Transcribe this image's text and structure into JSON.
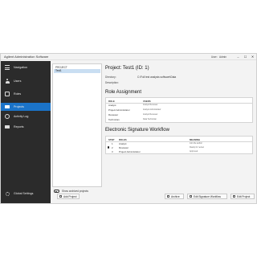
{
  "window": {
    "title": "Agilent Administration Software",
    "user_label": "User:",
    "user_value": "Admin",
    "minimize": "–",
    "maximize": "☐",
    "close": "✕"
  },
  "sidebar": {
    "items": [
      {
        "label": "Navigation",
        "icon": "menu-icon"
      },
      {
        "label": "Users",
        "icon": "user-icon"
      },
      {
        "label": "Roles",
        "icon": "roles-icon"
      },
      {
        "label": "Projects",
        "icon": "projects-icon",
        "active": true
      },
      {
        "label": "Activity Log",
        "icon": "activity-log-icon"
      },
      {
        "label": "Reports",
        "icon": "reports-icon"
      },
      {
        "label": "Global Settings",
        "icon": "gear-icon"
      }
    ]
  },
  "projects": {
    "header": "PROJECT",
    "items": [
      "Test1"
    ],
    "selected": "Test1",
    "show_archived_label": "Show archived projects",
    "add_button": "Add Project"
  },
  "details": {
    "title": "Project: Test1 (ID: 1)",
    "directory_label": "Directory:",
    "directory_value": "C:\\Full test analysis software\\Data",
    "description_label": "Description:",
    "description_value": "",
    "role_section_title": "Role Assignment",
    "role_table": {
      "headers": [
        "ROLE",
        "USERS"
      ],
      "rows": [
        {
          "role": "Analyst",
          "users": "Analyst Reviewer"
        },
        {
          "role": "Project Administrator",
          "users": "Analyst Administrator"
        },
        {
          "role": "Reviewer",
          "users": "Analyst Reviewer"
        },
        {
          "role": "Technician",
          "users": "Data Technician"
        }
      ]
    },
    "esig_section_title": "Electronic Signature Workflow",
    "esig_table": {
      "headers": [
        "STEP",
        "ROLES",
        "MEANING"
      ],
      "rows": [
        {
          "step": "1",
          "role": "Analyst",
          "meaning": "Join the author"
        },
        {
          "step": "2",
          "role": "Reviewer",
          "meaning": "Ready for review"
        },
        {
          "step": "3",
          "role": "Project Administrator",
          "meaning": "Approved"
        }
      ]
    }
  },
  "actions": {
    "archive": "Archive",
    "edit_signature": "Edit Signature Workflow",
    "edit_project": "Edit Project"
  }
}
